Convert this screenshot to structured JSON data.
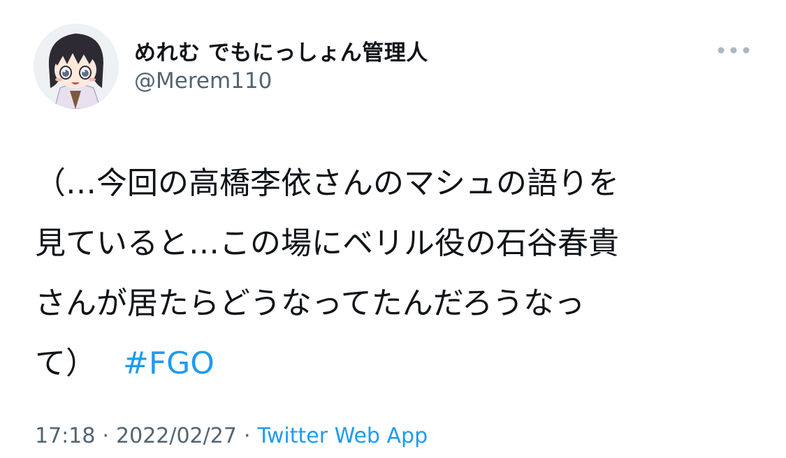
{
  "author": {
    "display_name": "めれむ でもにっしょん管理人",
    "handle": "@Merem110"
  },
  "tweet": {
    "lines": [
      "（…今回の高橋李依さんのマシュの語りを",
      "見ていると…この場にベリル役の石谷春貴",
      "さんが居たらどうなってたんだろうなっ",
      "て）"
    ],
    "hashtag": "#FGO"
  },
  "meta": {
    "time": "17:18",
    "separator": "·",
    "date": "2022/02/27",
    "source": "Twitter Web App"
  },
  "icons": {
    "more": "more-horizontal-icon",
    "avatar": "avatar-anime-character"
  },
  "colors": {
    "link": "#1d9bf0",
    "secondary_text": "#536471",
    "primary_text": "#0f1419"
  }
}
